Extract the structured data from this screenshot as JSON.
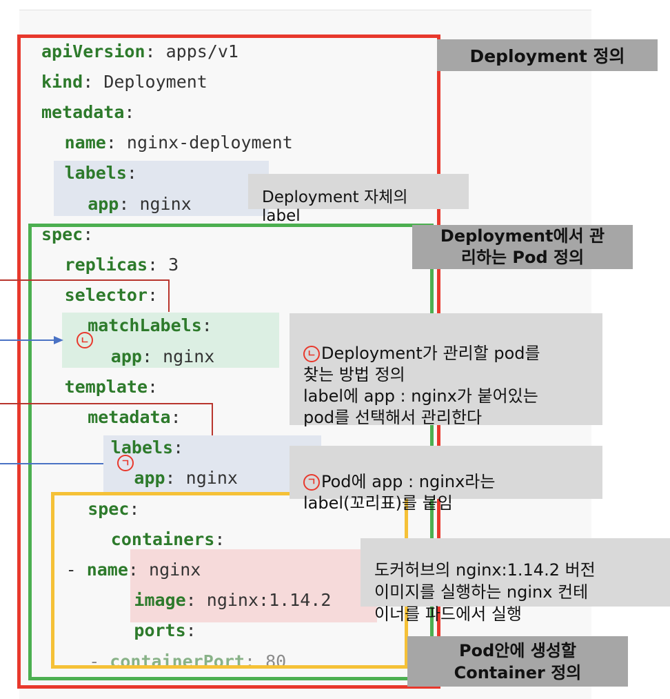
{
  "code_lines": [
    {
      "indent": 0,
      "key": "apiVersion",
      "value": " apps/v1"
    },
    {
      "indent": 0,
      "key": "kind",
      "value": " Deployment"
    },
    {
      "indent": 0,
      "key": "metadata",
      "value": ""
    },
    {
      "indent": 1,
      "key": "name",
      "value": " nginx-deployment"
    },
    {
      "indent": 1,
      "key": "labels",
      "value": ""
    },
    {
      "indent": 2,
      "key": "app",
      "value": " nginx"
    },
    {
      "indent": 0,
      "key": "spec",
      "value": ""
    },
    {
      "indent": 1,
      "key": "replicas",
      "value": " 3"
    },
    {
      "indent": 1,
      "key": "selector",
      "value": ""
    },
    {
      "indent": 2,
      "key": "matchLabels",
      "value": ""
    },
    {
      "indent": 3,
      "key": "app",
      "value": " nginx"
    },
    {
      "indent": 1,
      "key": "template",
      "value": ""
    },
    {
      "indent": 2,
      "key": "metadata",
      "value": ""
    },
    {
      "indent": 3,
      "key": "labels",
      "value": ""
    },
    {
      "indent": 4,
      "key": "app",
      "value": " nginx"
    },
    {
      "indent": 2,
      "key": "spec",
      "value": ""
    },
    {
      "indent": 3,
      "key": "containers",
      "value": ""
    },
    {
      "indent": 3,
      "dash": "- ",
      "key": "name",
      "value": " nginx"
    },
    {
      "indent": 4,
      "key": "image",
      "value": " nginx:1.14.2"
    },
    {
      "indent": 4,
      "key": "ports",
      "value": ""
    },
    {
      "indent": 4,
      "dash": "- ",
      "key": "containerPort",
      "value": " 80"
    }
  ],
  "notes": {
    "deployment_def": "Deployment  정의",
    "deployment_label": "Deployment 자체의\nlabel",
    "pod_managed": "Deployment에서 관\n리하는 Pod 정의",
    "selector_marker": "ㄴ",
    "selector_desc": "Deployment가 관리할 pod를\n찾는 방법 정의\nlabel에 app : nginx가 붙어있는\npod를 선택해서 관리한다",
    "template_marker": "ㄱ",
    "template_desc": "Pod에 app : nginx라는\nlabel(꼬리표)를 붙임",
    "image_desc": "도커허브의 nginx:1.14.2 버전\n이미지를 실행하는 nginx 컨테\n이너를 파드에서 실행",
    "container_def": "Pod안에 생성할\nContainer 정의"
  },
  "colors": {
    "deployment_box": "#e8382c",
    "pod_box": "#4caf50",
    "container_box": "#f5c137",
    "yaml_key": "#2d7a2b",
    "connector_red": "#b8352d",
    "connector_blue": "#4a72c4"
  }
}
